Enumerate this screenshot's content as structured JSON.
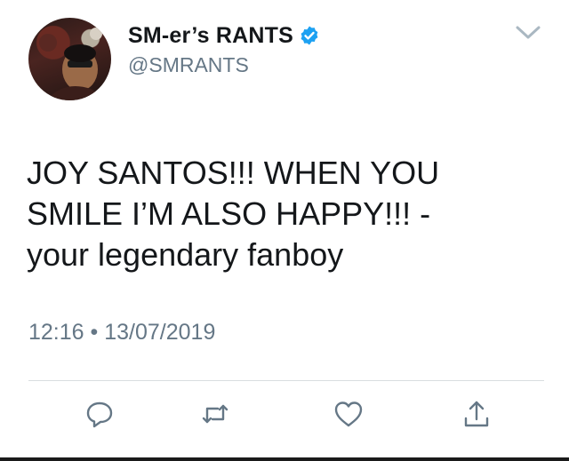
{
  "tweet": {
    "display_name": "SM-er’s RANTS",
    "handle": "@SMRANTS",
    "verified_icon": "verified-badge-icon",
    "text_line_1": "JOY SANTOS!!! WHEN YOU",
    "text_line_2": "SMILE I’M ALSO HAPPY!!! -",
    "text_line_3": "your legendary fanboy",
    "time": "12:16",
    "separator": "•",
    "date": "13/07/2019"
  },
  "actions": [
    {
      "name": "reply",
      "icon": "reply-icon"
    },
    {
      "name": "retweet",
      "icon": "retweet-icon"
    },
    {
      "name": "like",
      "icon": "heart-icon"
    },
    {
      "name": "share",
      "icon": "share-icon"
    }
  ],
  "colors": {
    "text": "#14171a",
    "secondary": "#657786",
    "verified": "#1da1f2",
    "divider": "#d9dde0"
  }
}
